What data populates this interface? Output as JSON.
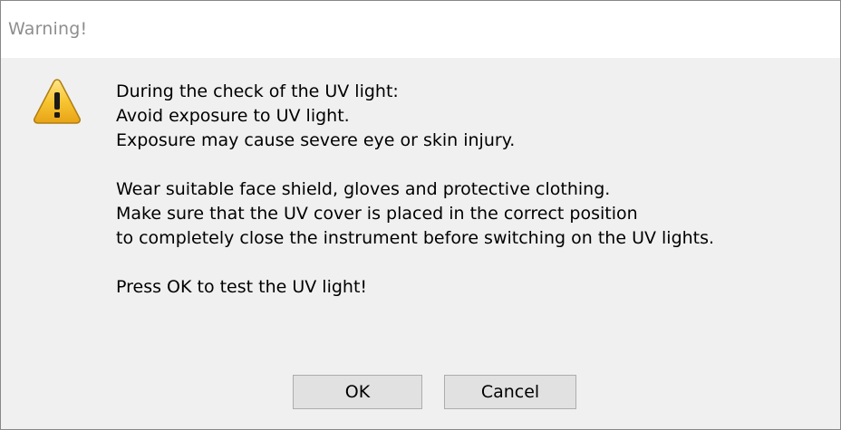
{
  "dialog": {
    "title": "Warning!",
    "icon": "warning-triangle-icon",
    "message_lines": [
      "During the check of the UV light:",
      "Avoid exposure to UV light.",
      "Exposure may cause severe eye or skin injury.",
      "",
      "Wear suitable face shield, gloves and protective clothing.",
      "Make sure that the UV cover is placed in the correct position",
      "to completely close the instrument before switching on the UV lights.",
      "",
      "Press OK to test the UV light!"
    ],
    "buttons": {
      "ok_label": "OK",
      "cancel_label": "Cancel"
    }
  },
  "colors": {
    "dialog_background": "#f0f0f0",
    "titlebar_background": "#ffffff",
    "title_text": "#8e8e8e",
    "button_background": "#e1e1e1",
    "button_border": "#adadad",
    "warning_yellow": "#f7c531",
    "warning_outline": "#b8860b"
  }
}
